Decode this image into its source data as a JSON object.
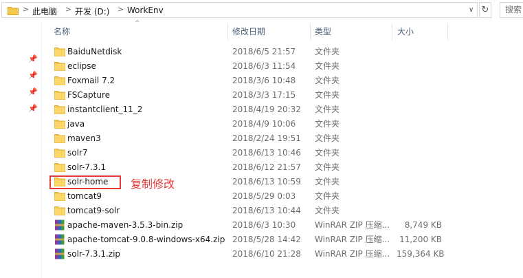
{
  "address": {
    "crumbs": [
      "此电脑",
      "开发 (D:)",
      "WorkEnv"
    ],
    "separator": ">",
    "search_placeholder": "搜索"
  },
  "columns": {
    "name": "名称",
    "date": "修改日期",
    "type": "类型",
    "size": "大小"
  },
  "files": [
    {
      "name": "BaiduNetdisk",
      "date": "2018/6/5 21:57",
      "type": "文件夹",
      "size": "",
      "icon": "folder-icon"
    },
    {
      "name": "eclipse",
      "date": "2018/6/3 11:54",
      "type": "文件夹",
      "size": "",
      "icon": "folder-icon"
    },
    {
      "name": "Foxmail 7.2",
      "date": "2018/3/6 10:48",
      "type": "文件夹",
      "size": "",
      "icon": "folder-icon"
    },
    {
      "name": "FSCapture",
      "date": "2018/3/3 17:15",
      "type": "文件夹",
      "size": "",
      "icon": "folder-icon"
    },
    {
      "name": "instantclient_11_2",
      "date": "2018/4/19 20:32",
      "type": "文件夹",
      "size": "",
      "icon": "folder-icon"
    },
    {
      "name": "java",
      "date": "2018/4/9 10:06",
      "type": "文件夹",
      "size": "",
      "icon": "folder-icon"
    },
    {
      "name": "maven3",
      "date": "2018/2/24 19:51",
      "type": "文件夹",
      "size": "",
      "icon": "folder-icon"
    },
    {
      "name": "solr7",
      "date": "2018/6/13 10:46",
      "type": "文件夹",
      "size": "",
      "icon": "folder-icon"
    },
    {
      "name": "solr-7.3.1",
      "date": "2018/6/12 21:57",
      "type": "文件夹",
      "size": "",
      "icon": "folder-icon"
    },
    {
      "name": "solr-home",
      "date": "2018/6/13 10:59",
      "type": "文件夹",
      "size": "",
      "icon": "folder-icon"
    },
    {
      "name": "tomcat9",
      "date": "2018/5/29 0:03",
      "type": "文件夹",
      "size": "",
      "icon": "folder-icon"
    },
    {
      "name": "tomcat9-solr",
      "date": "2018/6/13 10:44",
      "type": "文件夹",
      "size": "",
      "icon": "folder-icon"
    },
    {
      "name": "apache-maven-3.5.3-bin.zip",
      "date": "2018/6/3 10:30",
      "type": "WinRAR ZIP 压缩...",
      "size": "8,749 KB",
      "icon": "winrar-zip-icon"
    },
    {
      "name": "apache-tomcat-9.0.8-windows-x64.zip",
      "date": "2018/5/28 14:42",
      "type": "WinRAR ZIP 压缩...",
      "size": "11,200 KB",
      "icon": "winrar-zip-icon"
    },
    {
      "name": "solr-7.3.1.zip",
      "date": "2018/6/10 21:28",
      "type": "WinRAR ZIP 压缩...",
      "size": "159,364 KB",
      "icon": "winrar-zip-icon"
    }
  ],
  "annotation": {
    "text": "复制修改",
    "color": "#e53935"
  },
  "colors": {
    "folder": "#f7c94d",
    "header_text": "#4c607a",
    "annotation": "#e53935"
  }
}
